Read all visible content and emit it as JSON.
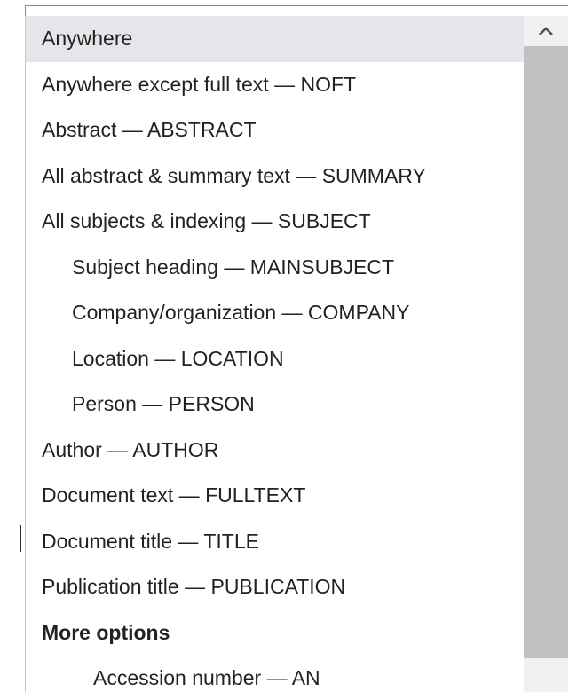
{
  "dropdown": {
    "options": [
      {
        "label": "Anywhere",
        "level": 0,
        "selected": true
      },
      {
        "label": "Anywhere except full text — NOFT",
        "level": 0
      },
      {
        "label": "Abstract — ABSTRACT",
        "level": 0
      },
      {
        "label": "All abstract & summary text — SUMMARY",
        "level": 0
      },
      {
        "label": "All subjects & indexing — SUBJECT",
        "level": 0
      },
      {
        "label": "Subject heading — MAINSUBJECT",
        "level": 1
      },
      {
        "label": "Company/organization — COMPANY",
        "level": 1
      },
      {
        "label": "Location — LOCATION",
        "level": 1
      },
      {
        "label": "Person — PERSON",
        "level": 1
      },
      {
        "label": "Author — AUTHOR",
        "level": 0
      },
      {
        "label": "Document text — FULLTEXT",
        "level": 0
      },
      {
        "label": "Document title — TITLE",
        "level": 0
      },
      {
        "label": "Publication title — PUBLICATION",
        "level": 0
      },
      {
        "label": "More options",
        "level": 0,
        "group_header": true
      },
      {
        "label": "Accession number — AN",
        "level": 2
      }
    ],
    "scrollbar": {
      "up_icon": "chevron-up-icon"
    }
  },
  "colors": {
    "selected_bg": "#e6e6ea",
    "text": "#222222",
    "scroll_track": "#f1f1f1",
    "scroll_thumb": "#c1c1c1"
  }
}
